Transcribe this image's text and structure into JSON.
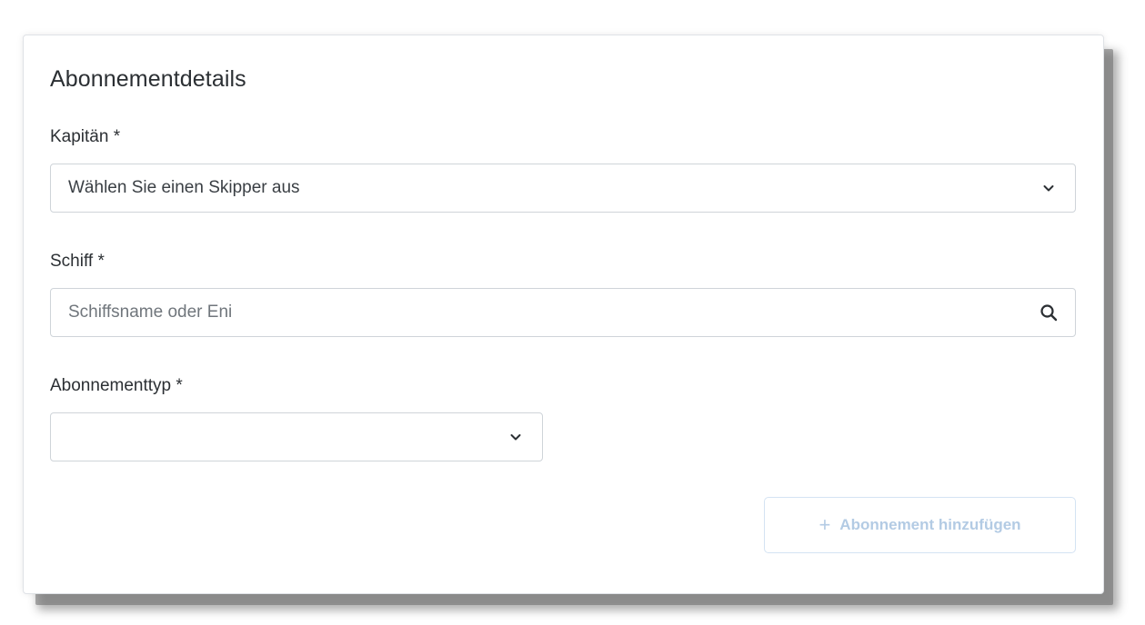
{
  "card": {
    "title": "Abonnementdetails"
  },
  "captain": {
    "label": "Kapitän *",
    "selected": "Wählen Sie einen Skipper aus",
    "icon": "chevron-down-icon"
  },
  "ship": {
    "label": "Schiff *",
    "value": "",
    "placeholder": "Schiffsname oder Eni",
    "icon": "search-icon"
  },
  "subscription_type": {
    "label": "Abonnementtyp *",
    "selected": "",
    "icon": "chevron-down-icon"
  },
  "add_button": {
    "label": "Abonnement hinzufügen",
    "icon": "plus-icon",
    "enabled": false
  },
  "colors": {
    "text": "#2b2f33",
    "border": "#cfd4d9",
    "disabled_button_text": "#b3cbe4",
    "disabled_button_border": "#d4e3f3"
  }
}
